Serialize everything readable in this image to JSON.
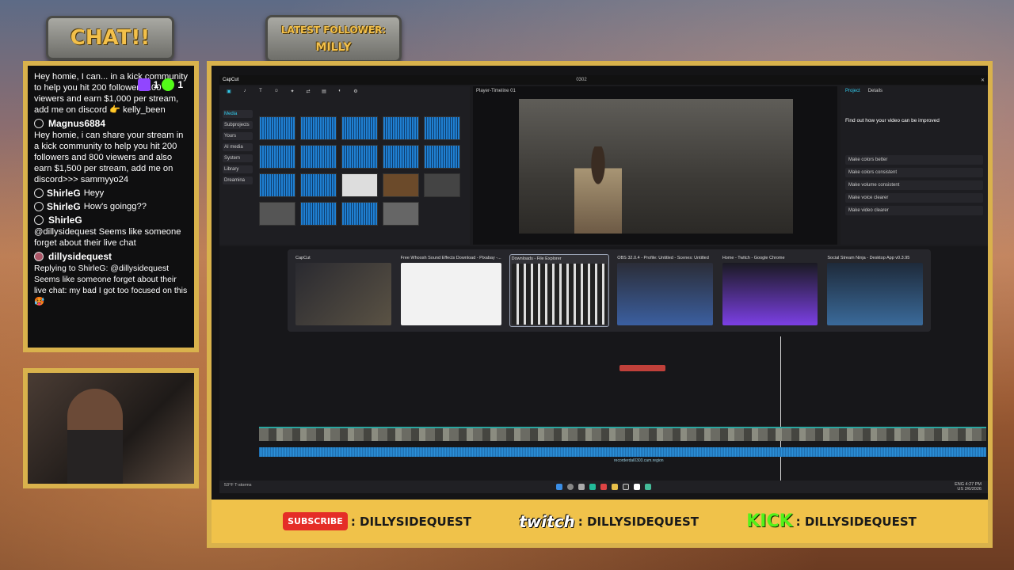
{
  "overlay": {
    "chat_title": "CHAT!!",
    "follower_label": "LATEST FOLLOWER:",
    "follower_name": "MILLY",
    "twitch_count": "1",
    "kick_count": "1"
  },
  "chat": {
    "messages": [
      {
        "user": "",
        "text": "Hey homie, I can... in a kick community to help you hit 200 followers 100 viewers and earn $1,000 per stream, add me on discord 👉 kelly_been"
      },
      {
        "user": "Magnus6884",
        "text": "Hey homie, i can share your stream in a kick community to help you hit 200 followers and 800 viewers and also earn $1,500 per stream, add me on discord>>> sammyyo24"
      },
      {
        "user": "ShirleG",
        "text": "Heyy"
      },
      {
        "user": "ShirleG",
        "text": "How's goingg??"
      },
      {
        "user": "ShirleG",
        "text": "@dillysidequest Seems like someone forget about their live chat"
      },
      {
        "user": "dillysidequest",
        "text": "Replying to ShirleG: @dillysidequest Seems like someone forget about their live chat: my bad I got too focused on this🥵"
      }
    ]
  },
  "footer": {
    "youtube_label": "SUBSCRIBE",
    "youtube_handle": ": DILLYSIDEQUEST",
    "twitch_label": "twitch",
    "twitch_handle": ": DILLYSIDEQUEST",
    "kick_label": "KICK",
    "kick_handle": ": DILLYSIDEQUEST"
  },
  "app": {
    "title": "CapCut",
    "window_title": "0302",
    "player_label": "Player-Timeline 01",
    "props_tabs": [
      "Project",
      "Details"
    ],
    "props_heading": "Find out how your video can be improved",
    "props_items": [
      "Make colors better",
      "Make colors consistent",
      "Make volume consistent",
      "Make voice clearer",
      "Make video clearer"
    ],
    "side_items": [
      "Media",
      "Subprojects",
      "Yours",
      "AI media",
      "System",
      "Library",
      "Dreamina"
    ],
    "clip_label": "recorderdal0303.cam.region"
  },
  "switcher": {
    "windows": [
      {
        "label": "CapCut"
      },
      {
        "label": "Free Whoosh Sound Effects Download - Pixabay -..."
      },
      {
        "label": "Downloads - File Explorer"
      },
      {
        "label": "OBS 32.0.4 - Profile: Untitled - Scenes: Untitled"
      },
      {
        "label": "Home - Twitch - Google Chrome"
      },
      {
        "label": "Social Stream Ninja - Desktop App v0.3.95"
      }
    ]
  },
  "taskbar": {
    "weather_temp": "53°F",
    "weather_text": "T-storms",
    "lang": "ENG",
    "region": "US",
    "time": "4:27 PM",
    "date": "2/6/2026"
  }
}
